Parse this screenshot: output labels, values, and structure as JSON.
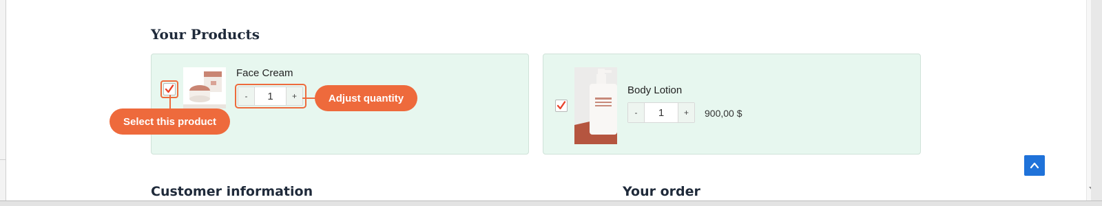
{
  "products_section": {
    "title": "Your Products",
    "items": [
      {
        "name": "Face Cream",
        "quantity": "1",
        "price": "",
        "selected": true,
        "minus_label": "-",
        "plus_label": "+"
      },
      {
        "name": "Body Lotion",
        "quantity": "1",
        "price": "900,00 $",
        "selected": true,
        "minus_label": "-",
        "plus_label": "+"
      }
    ]
  },
  "annotations": {
    "select_product": "Select this product",
    "adjust_quantity": "Adjust quantity"
  },
  "headings": {
    "customer_information": "Customer information",
    "your_order": "Your order"
  },
  "icons": {
    "checkmark": "checkmark-icon",
    "scroll_top": "chevron-up-icon",
    "scroll_down": "scroll-down-arrow-icon"
  },
  "colors": {
    "accent": "#ee6a3c",
    "card_background": "#e7f7ef",
    "scroll_button": "#1f72d9"
  }
}
